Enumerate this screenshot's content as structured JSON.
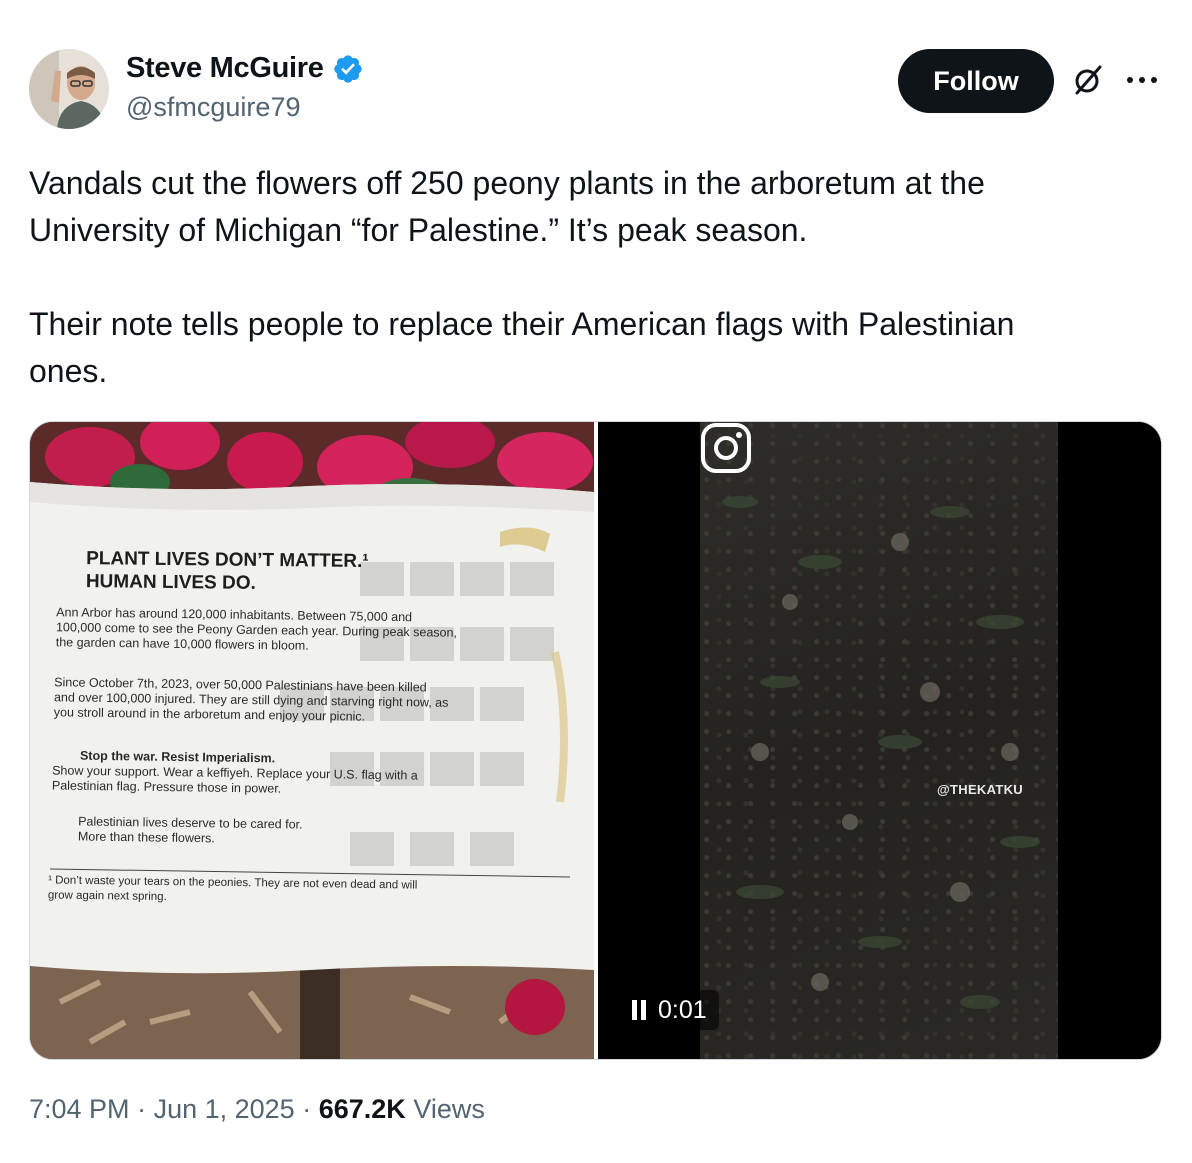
{
  "author": {
    "name": "Steve McGuire",
    "handle": "@sfmcguire79",
    "verified": true,
    "avatar_icon": "avatar"
  },
  "actions": {
    "follow_label": "Follow",
    "grok_icon": "grok-icon",
    "more_icon": "more-icon"
  },
  "tweet": {
    "text": "Vandals cut the flowers off 250 peony plants in the arboretum at the\nUniversity of Michigan “for Palestine.” It’s peak season.\n\nTheir note tells people to replace their American flags with Palestinian\nones."
  },
  "media": {
    "image": {
      "sign_title": "PLANT LIVES DON’T MATTER.¹\nHUMAN LIVES DO.",
      "paragraph1": "Ann Arbor has around 120,000 inhabitants. Between 75,000 and\n100,000 come to see the Peony Garden each year. During peak season,\nthe garden can have 10,000 flowers in bloom.",
      "paragraph2": "Since October 7th, 2023, over 50,000 Palestinians have been killed\nand over 100,000 injured. They are still dying and starving right now, as\nyou stroll around in the arboretum and enjoy your picnic.",
      "paragraph3_bold": "Stop the war. Resist Imperialism.",
      "paragraph3": "Show your support. Wear a keffiyeh. Replace your U.S. flag with a\nPalestinian flag. Pressure those in power.",
      "paragraph4": "Palestinian lives deserve to be cared for.\nMore than these flowers.",
      "footnote": "¹ Don’t waste your tears on the peonies. They are not even dead and will\ngrow again next spring."
    },
    "video": {
      "watermark": "@THEKATKU",
      "elapsed": "0:01",
      "state": "paused-icon-shown",
      "watermark_icon": "instagram-icon"
    }
  },
  "footer": {
    "time": "7:04 PM",
    "date": "Jun 1, 2025",
    "views_count": "667.2K",
    "views_label": "Views"
  },
  "colors": {
    "verified": "#1d9bf0",
    "follow_bg": "#0f1419",
    "secondary_text": "#536471"
  }
}
